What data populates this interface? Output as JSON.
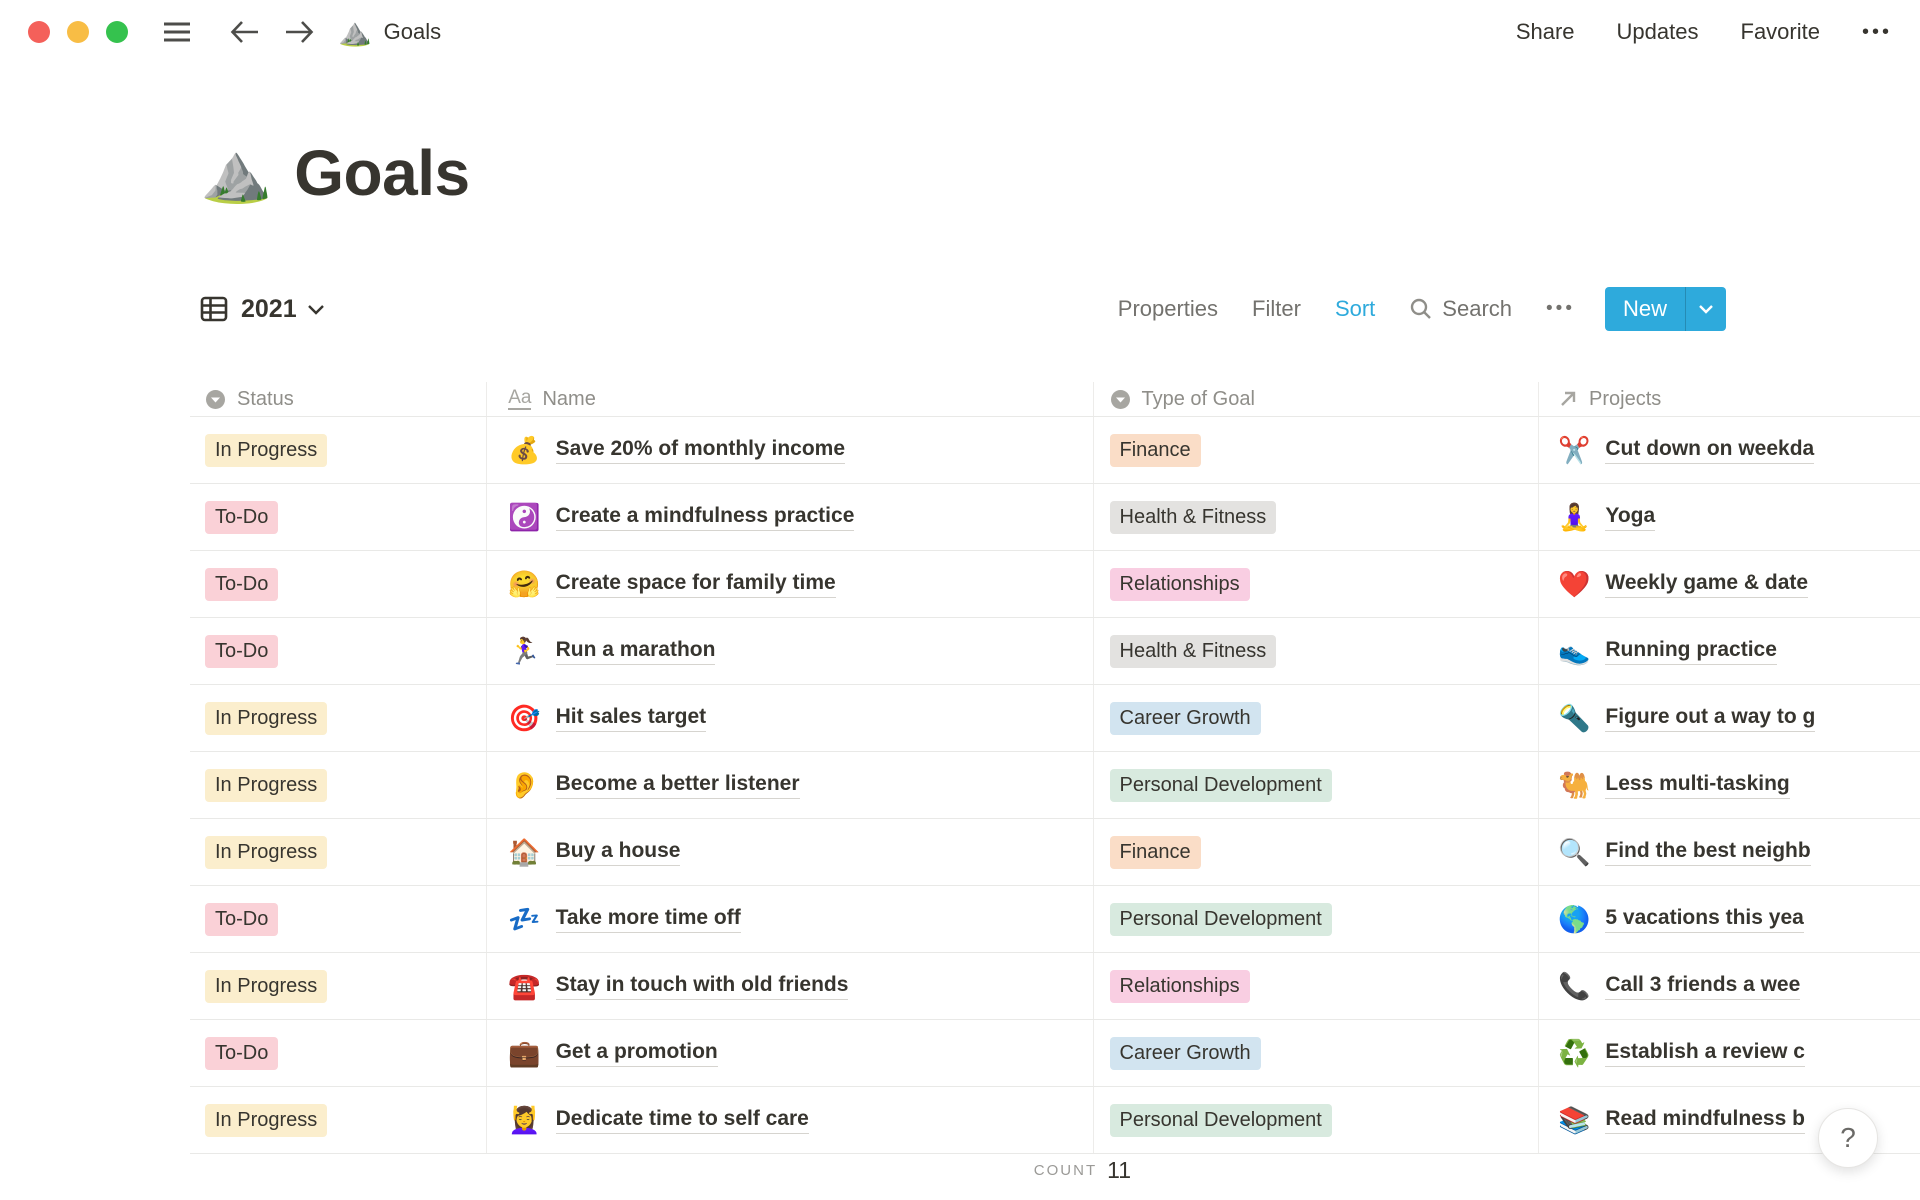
{
  "topbar": {
    "doc_emoji": "⛰️",
    "doc_title": "Goals",
    "share": "Share",
    "updates": "Updates",
    "favorite": "Favorite",
    "more": "•••"
  },
  "page": {
    "emoji": "⛰️",
    "title": "Goals"
  },
  "toolbar": {
    "view_name": "2021",
    "properties": "Properties",
    "filter": "Filter",
    "sort": "Sort",
    "search": "Search",
    "more": "•••",
    "new_label": "New"
  },
  "columns": [
    {
      "label": "Status",
      "icon": "select-icon"
    },
    {
      "label": "Name",
      "icon": "text-icon"
    },
    {
      "label": "Type of Goal",
      "icon": "select-icon"
    },
    {
      "label": "Projects",
      "icon": "relation-icon"
    }
  ],
  "rows": [
    {
      "status": "In Progress",
      "name_emoji": "💰",
      "name": "Save 20% of monthly income",
      "type": "Finance",
      "project_emoji": "✂️",
      "project": "Cut down on weekda"
    },
    {
      "status": "To-Do",
      "name_emoji": "☯️",
      "name": "Create a mindfulness practice",
      "type": "Health & Fitness",
      "project_emoji": "🧘‍♀️",
      "project": "Yoga"
    },
    {
      "status": "To-Do",
      "name_emoji": "🤗",
      "name": "Create space for family time",
      "type": "Relationships",
      "project_emoji": "❤️",
      "project": "Weekly game & date"
    },
    {
      "status": "To-Do",
      "name_emoji": "🏃‍♀️",
      "name": "Run a marathon",
      "type": "Health & Fitness",
      "project_emoji": "👟",
      "project": "Running practice"
    },
    {
      "status": "In Progress",
      "name_emoji": "🎯",
      "name": "Hit sales target",
      "type": "Career Growth",
      "project_emoji": "🔦",
      "project": "Figure out a way to g"
    },
    {
      "status": "In Progress",
      "name_emoji": "👂",
      "name": "Become a better listener",
      "type": "Personal Development",
      "project_emoji": "🐫",
      "project": "Less multi-tasking"
    },
    {
      "status": "In Progress",
      "name_emoji": "🏠",
      "name": "Buy a house",
      "type": "Finance",
      "project_emoji": "🔍",
      "project": "Find the best neighb"
    },
    {
      "status": "To-Do",
      "name_emoji": "💤",
      "name": "Take more time off",
      "type": "Personal Development",
      "project_emoji": "🌎",
      "project": "5 vacations this yea"
    },
    {
      "status": "In Progress",
      "name_emoji": "☎️",
      "name": "Stay in touch with old friends",
      "type": "Relationships",
      "project_emoji": "📞",
      "project": "Call 3 friends a wee"
    },
    {
      "status": "To-Do",
      "name_emoji": "💼",
      "name": "Get a promotion",
      "type": "Career Growth",
      "project_emoji": "♻️",
      "project": "Establish a review c"
    },
    {
      "status": "In Progress",
      "name_emoji": "💆‍♀️",
      "name": "Dedicate time to self care",
      "type": "Personal Development",
      "project_emoji": "📚",
      "project": "Read mindfulness b"
    }
  ],
  "footer": {
    "count_label": "COUNT",
    "count_value": "11"
  },
  "help_button": "?",
  "colors": {
    "accent_blue": "#2EAADC",
    "status": {
      "In Progress": "#FBEECD",
      "To-Do": "#FAD1D7"
    },
    "types": {
      "Finance": "#FADDC7",
      "Health & Fitness": "#E3E2E0",
      "Relationships": "#F9CEE2",
      "Career Growth": "#D2E4F0",
      "Personal Development": "#D8EADF"
    }
  }
}
